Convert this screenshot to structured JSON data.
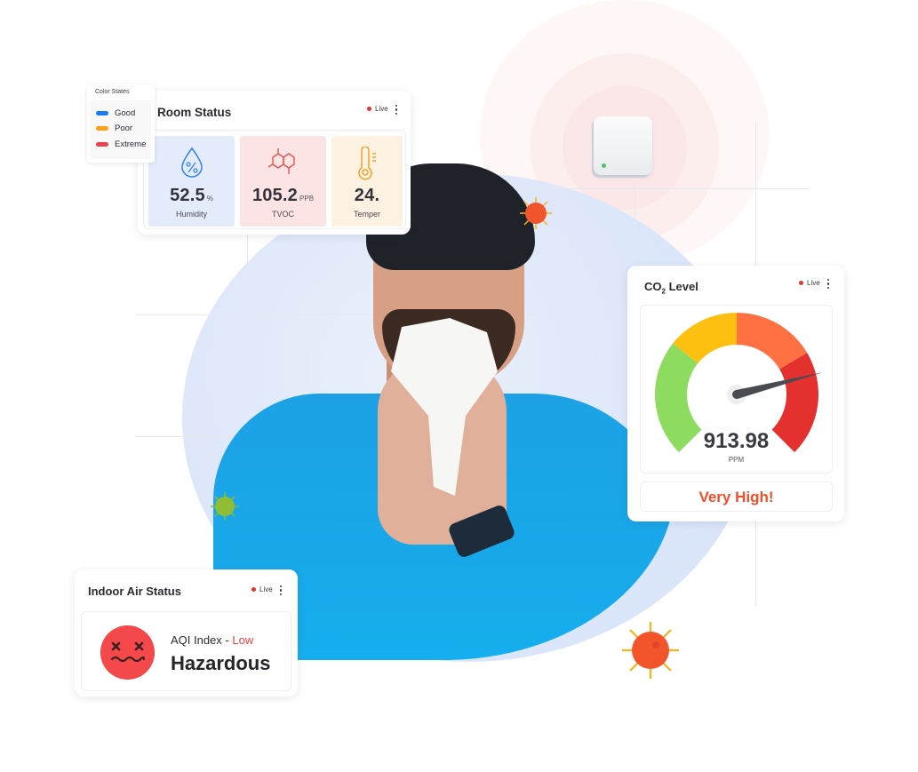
{
  "legend": {
    "title": "Color States",
    "items": [
      {
        "label": "Good",
        "color": "#1a7cf5"
      },
      {
        "label": "Poor",
        "color": "#ff9f1a"
      },
      {
        "label": "Extreme",
        "color": "#e8434a"
      }
    ]
  },
  "live_label": "Live",
  "room_status": {
    "title": "Room Status",
    "metrics": [
      {
        "icon": "humidity-drop-icon",
        "value": "52.5",
        "unit": "%",
        "label": "Humidity",
        "bg": "#e4ecfc",
        "icon_color": "#2f7ff0"
      },
      {
        "icon": "tvoc-molecule-icon",
        "value": "105.2",
        "unit": "PPB",
        "label": "TVOC",
        "bg": "#fde4e4",
        "icon_color": "#e8514f"
      },
      {
        "icon": "thermometer-icon",
        "value": "24.",
        "unit": "",
        "label": "Temper",
        "bg": "#fdf1e2",
        "icon_color": "#f3a224"
      }
    ]
  },
  "co2": {
    "title_prefix": "CO",
    "title_sub": "2",
    "title_suffix": " Level",
    "value": "913.98",
    "unit": "PPM",
    "status": "Very High!",
    "gauge_fraction": 0.78,
    "segments": [
      {
        "name": "good",
        "color": "#8ddc5f"
      },
      {
        "name": "moderate",
        "color": "#fdbf10"
      },
      {
        "name": "high",
        "color": "#ff7043"
      },
      {
        "name": "very-high",
        "color": "#e53030"
      }
    ]
  },
  "indoor_air": {
    "title": "Indoor Air Status",
    "aqi_label": "AQI Index - ",
    "aqi_level": "Low",
    "status": "Hazardous"
  }
}
